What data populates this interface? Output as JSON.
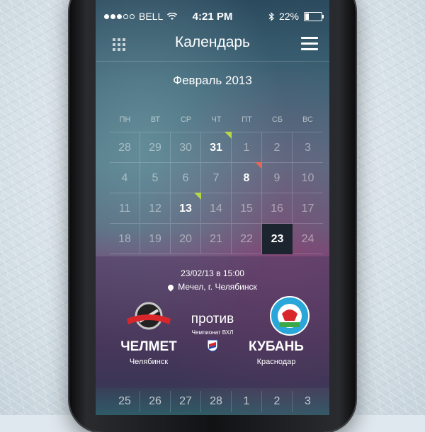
{
  "status_bar": {
    "carrier": "BELL",
    "time": "4:21 PM",
    "battery": "22%",
    "signal_bars": 3
  },
  "header": {
    "title": "Календарь",
    "left_icon": "grid-icon",
    "right_icon": "menu-icon"
  },
  "calendar": {
    "month_title": "Февраль 2013",
    "weekdays": [
      "ПН",
      "ВТ",
      "СР",
      "ЧТ",
      "ПТ",
      "СБ",
      "ВС"
    ],
    "rows": [
      [
        "28",
        "29",
        "30",
        "31",
        "1",
        "2",
        "3"
      ],
      [
        "4",
        "5",
        "6",
        "7",
        "8",
        "9",
        "10"
      ],
      [
        "11",
        "12",
        "13",
        "14",
        "15",
        "16",
        "17"
      ],
      [
        "18",
        "19",
        "20",
        "21",
        "22",
        "23",
        "24"
      ]
    ],
    "highlighted": [
      "31",
      "8",
      "13"
    ],
    "selected": "23",
    "next_row": [
      "25",
      "26",
      "27",
      "28",
      "1",
      "2",
      "3"
    ],
    "flag_colors": {
      "green": "#b8d84a",
      "red": "#e06a5a"
    }
  },
  "event": {
    "datetime": "23/02/13 в 15:00",
    "location": "Мечел, г. Челябинск",
    "versus": "против",
    "championship": "Чемпионат ВХЛ",
    "home": {
      "name": "ЧЕЛМЕТ",
      "city": "Челябинск",
      "logo_text": "chelmet"
    },
    "away": {
      "name": "КУБАНЬ",
      "city": "Краснодар"
    }
  }
}
